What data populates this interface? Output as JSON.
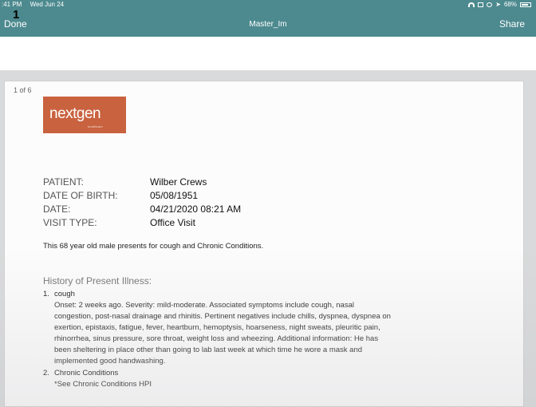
{
  "status_bar": {
    "time": ":41 PM",
    "date": "Wed Jun 24",
    "battery": "68%"
  },
  "page_badge": "1",
  "nav": {
    "done_label": "Done",
    "title": "Master_Im",
    "share_label": "Share"
  },
  "document": {
    "page_count": "1 of 6",
    "logo_text": "nextgen",
    "logo_tagline": "healthcare",
    "fields": [
      {
        "label": "PATIENT:",
        "value": "Wilber Crews"
      },
      {
        "label": "DATE OF BIRTH:",
        "value": "05/08/1951"
      },
      {
        "label": "DATE:",
        "value": "04/21/2020 08:21 AM"
      },
      {
        "label": "VISIT TYPE:",
        "value": "Office Visit"
      }
    ],
    "summary": "This 68 year old male presents for cough and Chronic Conditions.",
    "hpi_heading": "History of Present Illness:",
    "items": [
      {
        "number": "1.",
        "title": "cough",
        "lines": [
          "Onset: 2 weeks ago.  Severity: mild-moderate.  Associated symptoms include cough, nasal",
          "congestion, post-nasal drainage and rhinitis.  Pertinent negatives include chills, dyspnea, dyspnea on",
          "exertion, epistaxis, fatigue, fever, heartburn, hemoptysis, hoarseness, night sweats, pleuritic pain,",
          "rhinorrhea, sinus pressure, sore throat, weight loss and wheezing.  Additional information: He has",
          "been sheltering in place other than going to lab last week at which time he wore a mask and",
          "implemented  good handwashing."
        ]
      },
      {
        "number": "2.",
        "title": "Chronic Conditions",
        "lines": [
          "*See Chronic Conditions HPI"
        ]
      }
    ]
  }
}
